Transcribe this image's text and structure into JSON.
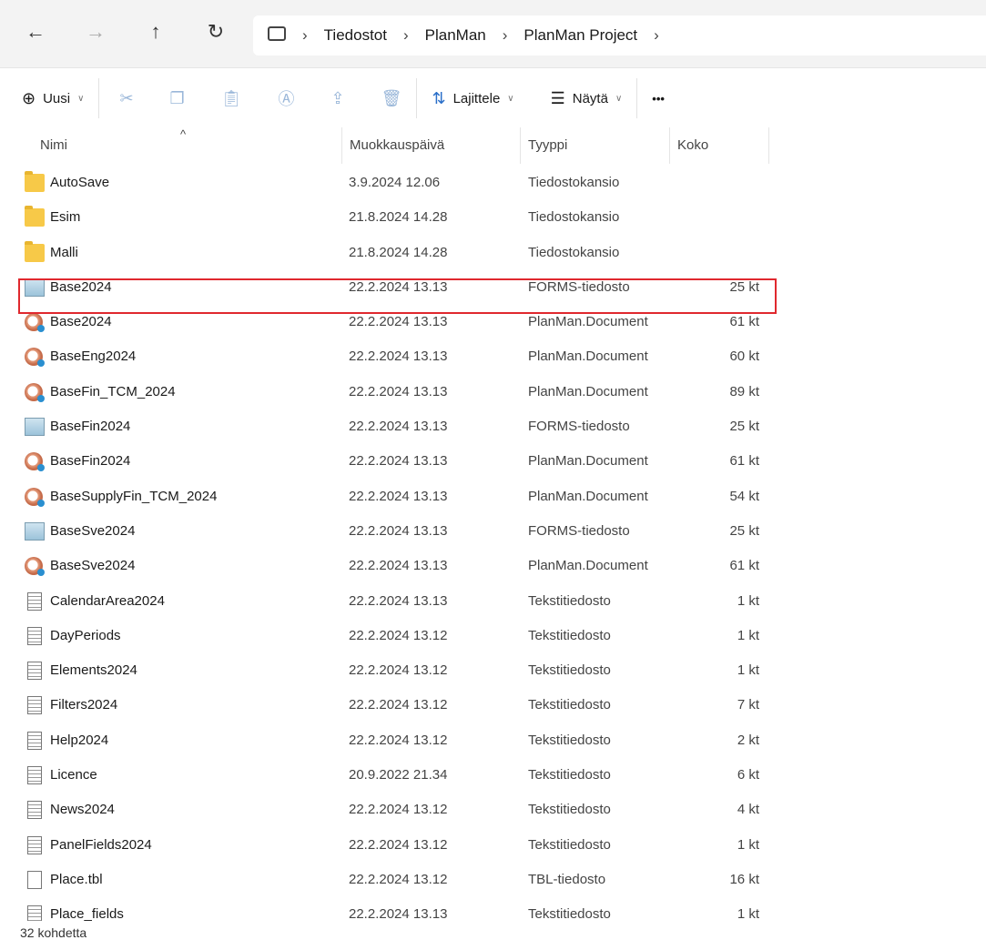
{
  "nav": {
    "back": "←",
    "forward": "→",
    "up": "↑",
    "refresh": "↻"
  },
  "breadcrumb": [
    "Tiedostot",
    "PlanMan",
    "PlanMan Project"
  ],
  "toolbar": {
    "new": "Uusi",
    "sort": "Lajittele",
    "view": "Näytä",
    "more": "•••"
  },
  "columns": {
    "name": "Nimi",
    "date": "Muokkauspäivä",
    "type": "Tyyppi",
    "size": "Koko"
  },
  "files": [
    {
      "icon": "folder",
      "name": "AutoSave",
      "date": "3.9.2024 12.06",
      "type": "Tiedostokansio",
      "size": ""
    },
    {
      "icon": "folder",
      "name": "Esim",
      "date": "21.8.2024 14.28",
      "type": "Tiedostokansio",
      "size": ""
    },
    {
      "icon": "folder",
      "name": "Malli",
      "date": "21.8.2024 14.28",
      "type": "Tiedostokansio",
      "size": ""
    },
    {
      "icon": "forms",
      "name": "Base2024",
      "date": "22.2.2024 13.13",
      "type": "FORMS-tiedosto",
      "size": "25 kt"
    },
    {
      "icon": "doc",
      "name": "Base2024",
      "date": "22.2.2024 13.13",
      "type": "PlanMan.Document",
      "size": "61 kt"
    },
    {
      "icon": "doc",
      "name": "BaseEng2024",
      "date": "22.2.2024 13.13",
      "type": "PlanMan.Document",
      "size": "60 kt"
    },
    {
      "icon": "doc",
      "name": "BaseFin_TCM_2024",
      "date": "22.2.2024 13.13",
      "type": "PlanMan.Document",
      "size": "89 kt"
    },
    {
      "icon": "forms",
      "name": "BaseFin2024",
      "date": "22.2.2024 13.13",
      "type": "FORMS-tiedosto",
      "size": "25 kt"
    },
    {
      "icon": "doc",
      "name": "BaseFin2024",
      "date": "22.2.2024 13.13",
      "type": "PlanMan.Document",
      "size": "61 kt"
    },
    {
      "icon": "doc",
      "name": "BaseSupplyFin_TCM_2024",
      "date": "22.2.2024 13.13",
      "type": "PlanMan.Document",
      "size": "54 kt"
    },
    {
      "icon": "forms",
      "name": "BaseSve2024",
      "date": "22.2.2024 13.13",
      "type": "FORMS-tiedosto",
      "size": "25 kt"
    },
    {
      "icon": "doc",
      "name": "BaseSve2024",
      "date": "22.2.2024 13.13",
      "type": "PlanMan.Document",
      "size": "61 kt"
    },
    {
      "icon": "txt",
      "name": "CalendarArea2024",
      "date": "22.2.2024 13.13",
      "type": "Tekstitiedosto",
      "size": "1 kt"
    },
    {
      "icon": "txt",
      "name": "DayPeriods",
      "date": "22.2.2024 13.12",
      "type": "Tekstitiedosto",
      "size": "1 kt"
    },
    {
      "icon": "txt",
      "name": "Elements2024",
      "date": "22.2.2024 13.12",
      "type": "Tekstitiedosto",
      "size": "1 kt"
    },
    {
      "icon": "txt",
      "name": "Filters2024",
      "date": "22.2.2024 13.12",
      "type": "Tekstitiedosto",
      "size": "7 kt"
    },
    {
      "icon": "txt",
      "name": "Help2024",
      "date": "22.2.2024 13.12",
      "type": "Tekstitiedosto",
      "size": "2 kt"
    },
    {
      "icon": "txt",
      "name": "Licence",
      "date": "20.9.2022 21.34",
      "type": "Tekstitiedosto",
      "size": "6 kt"
    },
    {
      "icon": "txt",
      "name": "News2024",
      "date": "22.2.2024 13.12",
      "type": "Tekstitiedosto",
      "size": "4 kt"
    },
    {
      "icon": "txt",
      "name": "PanelFields2024",
      "date": "22.2.2024 13.12",
      "type": "Tekstitiedosto",
      "size": "1 kt"
    },
    {
      "icon": "blank",
      "name": "Place.tbl",
      "date": "22.2.2024 13.12",
      "type": "TBL-tiedosto",
      "size": "16 kt"
    },
    {
      "icon": "txt",
      "name": "Place_fields",
      "date": "22.2.2024 13.13",
      "type": "Tekstitiedosto",
      "size": "1 kt"
    }
  ],
  "status": "32 kohdetta",
  "highlight_color": "#e0282e"
}
